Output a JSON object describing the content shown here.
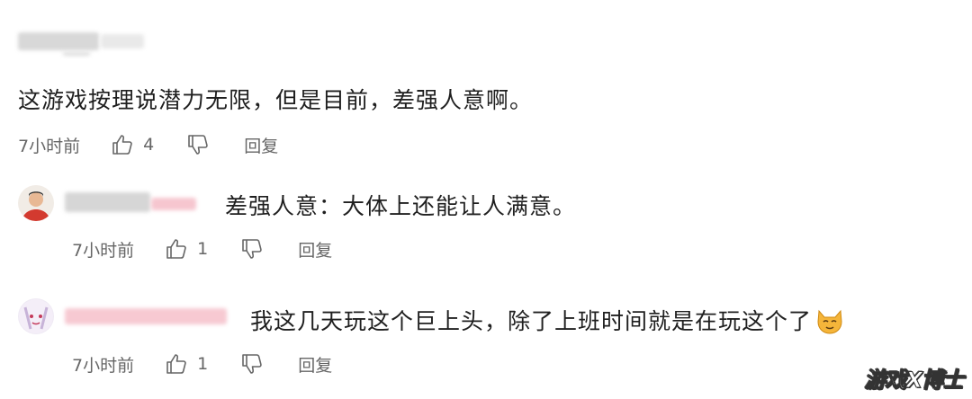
{
  "comments": [
    {
      "text": "这游戏按理说潜力无限，但是目前，差强人意啊。",
      "time": "7小时前",
      "likes": "4",
      "reply_label": "回复"
    },
    {
      "text": "差强人意：大体上还能让人满意。",
      "time": "7小时前",
      "likes": "1",
      "reply_label": "回复"
    },
    {
      "text": "我这几天玩这个巨上头，除了上班时间就是在玩这个了",
      "emoji": "cat-face-emoji",
      "time": "7小时前",
      "likes": "1",
      "reply_label": "回复"
    }
  ],
  "watermark": "游戏X博士",
  "icons": {
    "like": "thumbs-up-icon",
    "dislike": "thumbs-down-icon"
  },
  "colors": {
    "text": "#1f1f1f",
    "meta": "#666666",
    "blur_pink": "#f6c6cf"
  }
}
